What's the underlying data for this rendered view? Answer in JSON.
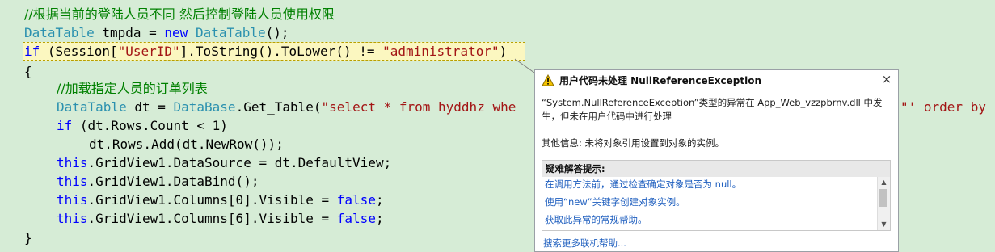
{
  "editor": {
    "lines": [
      {
        "parts": [
          {
            "t": "//根据当前的登陆人员不同 然后控制登陆人员使用权限",
            "c": "cm"
          }
        ]
      },
      {
        "parts": [
          {
            "t": "DataTable",
            "c": "ty"
          },
          {
            "t": " tmpda = ",
            "c": "pl"
          },
          {
            "t": "new",
            "c": "kw"
          },
          {
            "t": " ",
            "c": "pl"
          },
          {
            "t": "DataTable",
            "c": "ty"
          },
          {
            "t": "();",
            "c": "pl"
          }
        ]
      },
      {
        "parts": [
          {
            "t": "if",
            "c": "kw"
          },
          {
            "t": " (Session[",
            "c": "pl"
          },
          {
            "t": "\"UserID\"",
            "c": "str"
          },
          {
            "t": "].ToString().ToLower() != ",
            "c": "pl"
          },
          {
            "t": "\"administrator\"",
            "c": "str"
          },
          {
            "t": ")",
            "c": "pl"
          }
        ]
      },
      {
        "parts": [
          {
            "t": "{",
            "c": "pl"
          }
        ]
      },
      {
        "parts": [
          {
            "t": "//加载指定人员的订单列表",
            "c": "cm"
          }
        ]
      },
      {
        "parts": [
          {
            "t": "DataTable",
            "c": "ty"
          },
          {
            "t": " dt = ",
            "c": "pl"
          },
          {
            "t": "DataBase",
            "c": "ty"
          },
          {
            "t": ".Get_Table(",
            "c": "pl"
          },
          {
            "t": "\"select * from hyddhz whe",
            "c": "str"
          }
        ]
      },
      {
        "parts": [
          {
            "t": "if",
            "c": "kw"
          },
          {
            "t": " (dt.Rows.Count < 1)",
            "c": "pl"
          }
        ]
      },
      {
        "parts": [
          {
            "t": "dt.Rows.Add(dt.NewRow());",
            "c": "pl"
          }
        ]
      },
      {
        "parts": [
          {
            "t": "this",
            "c": "kw"
          },
          {
            "t": ".GridView1.DataSource = dt.DefaultView;",
            "c": "pl"
          }
        ]
      },
      {
        "parts": [
          {
            "t": "this",
            "c": "kw"
          },
          {
            "t": ".GridView1.DataBind();",
            "c": "pl"
          }
        ]
      },
      {
        "parts": [
          {
            "t": "this",
            "c": "kw"
          },
          {
            "t": ".GridView1.Columns[0].Visible = ",
            "c": "pl"
          },
          {
            "t": "false",
            "c": "kw"
          },
          {
            "t": ";",
            "c": "pl"
          }
        ]
      },
      {
        "parts": [
          {
            "t": "this",
            "c": "kw"
          },
          {
            "t": ".GridView1.Columns[6].Visible = ",
            "c": "pl"
          },
          {
            "t": "false",
            "c": "kw"
          },
          {
            "t": ";",
            "c": "pl"
          }
        ]
      },
      {
        "parts": [
          {
            "t": "}",
            "c": "pl"
          }
        ]
      }
    ],
    "truncated_tail": [
      {
        "t": "\"' order by",
        "c": "str"
      }
    ]
  },
  "exception_popup": {
    "title": "用户代码未处理 NullReferenceException",
    "close_glyph": "×",
    "message_line1": "“System.NullReferenceException”类型的异常在 App_Web_vzzpbrnv.dll 中发",
    "message_line2": "生，但未在用户代码中进行处理",
    "additional_info": "其他信息: 未将对象引用设置到对象的实例。",
    "hints_header": "疑难解答提示:",
    "hints": [
      "在调用方法前，通过检查确定对象是否为 null。",
      "使用“new”关键字创建对象实例。",
      "获取此异常的常规帮助。"
    ],
    "more_help_link": "搜索更多联机帮助..."
  },
  "colors": {
    "editor_background": "#d6ecd6",
    "keyword": "#0000ff",
    "type": "#2b91af",
    "string": "#a31515",
    "comment": "#008000",
    "highlight_line": "#fbf7c0",
    "link": "#1f5fbf"
  },
  "icons": {
    "warning": "warning-icon",
    "close": "close-icon",
    "scroll_up": "scroll-up-icon",
    "scroll_down": "scroll-down-icon"
  }
}
